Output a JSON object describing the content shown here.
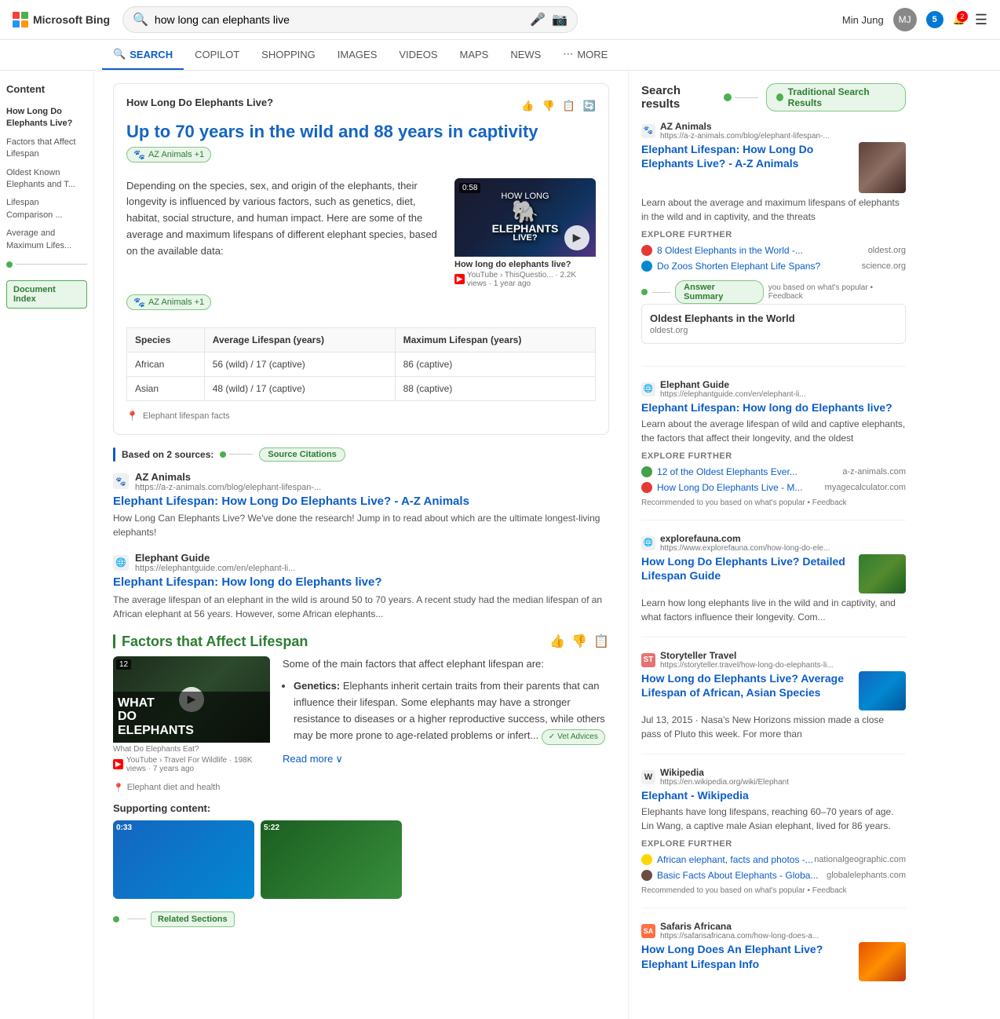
{
  "header": {
    "logo_text": "Microsoft Bing",
    "search_value": "how long can elephants live",
    "user_name": "Min Jung",
    "reward_count": "5",
    "notif_count": "2"
  },
  "nav": {
    "tabs": [
      {
        "label": "SEARCH",
        "icon": "🔍",
        "active": true
      },
      {
        "label": "COPILOT",
        "active": false
      },
      {
        "label": "SHOPPING",
        "active": false
      },
      {
        "label": "IMAGES",
        "active": false
      },
      {
        "label": "VIDEOS",
        "active": false
      },
      {
        "label": "MAPS",
        "active": false
      },
      {
        "label": "NEWS",
        "active": false
      },
      {
        "label": "MORE",
        "active": false
      }
    ]
  },
  "sidebar": {
    "content_label": "Content",
    "items": [
      {
        "label": "How Long Do Elephants Live?",
        "active": true
      },
      {
        "label": "Factors that Affect Lifespan"
      },
      {
        "label": "Oldest Known Elephants and T..."
      },
      {
        "label": "Lifespan Comparison ..."
      },
      {
        "label": "Average and Maximum Lifes..."
      }
    ],
    "doc_index_label": "Document Index"
  },
  "answer": {
    "title": "How Long Do Elephants Live?",
    "main_text": "Up to 70 years in the wild and 88 years in captivity",
    "source_badge": "AZ Animals +1",
    "body_text": "Depending on the species, sex, and origin of the elephants, their longevity is influenced by various factors, such as genetics, diet, habitat, social structure, and human impact. Here are some of the average and maximum lifespans of different elephant species, based on the available data:",
    "source_tag2": "AZ Animals +1",
    "location_text": "Elephant lifespan facts",
    "video": {
      "duration": "0:58",
      "title": "How long do elephants live?",
      "source": "YouTube › ThisQuestio... · 2.2K views · 1 year ago"
    },
    "table": {
      "headers": [
        "Species",
        "Average Lifespan (years)",
        "Maximum Lifespan (years)"
      ],
      "rows": [
        [
          "African",
          "56 (wild) / 17 (captive)",
          "86 (captive)"
        ],
        [
          "Asian",
          "48 (wild) / 17 (captive)",
          "88 (captive)"
        ]
      ]
    }
  },
  "source_citations": {
    "label": "Based on 2 sources:",
    "badge_label": "Source Citations",
    "sources": [
      {
        "icon": "🐾",
        "site": "AZ Animals",
        "url": "https://a-z-animals.com/blog/elephant-lifespan-...",
        "title": "Elephant Lifespan: How Long Do Elephants Live? - A-Z Animals",
        "desc": "How Long Can Elephants Live? We've done the research! Jump in to read about which are the ultimate longest-living elephants!"
      },
      {
        "icon": "🌐",
        "site": "Elephant Guide",
        "url": "https://elephantguide.com/en/elephant-li...",
        "title": "Elephant Lifespan: How long do Elephants live?",
        "desc": "The average lifespan of an elephant in the wild is around 50 to 70 years. A recent study had the median lifespan of an African elephant at 56 years. However, some African elephants..."
      }
    ]
  },
  "factors_section": {
    "title": "Factors that Affect Lifespan",
    "video": {
      "duration": "12",
      "title": "WHAT DO ELEPHANTS",
      "subtitle": "What Do Elephants Eat?",
      "meta": "YouTube › Travel For Wildlife · 198K views · 7 years ago"
    },
    "intro": "Some of the main factors that affect elephant lifespan are:",
    "factors": [
      {
        "keyword": "Genetics:",
        "text": "Elephants inherit certain traits from their parents that can influence their lifespan. Some elephants may have a stronger resistance to diseases or a higher reproductive success, while others may be more prone to age-related problems or infert..."
      },
      {
        "vet_badge": "Vet Advices"
      }
    ],
    "read_more": "Read more",
    "footer_location": "Elephant diet and health",
    "supporting_title": "Supporting content:"
  },
  "related_sections": {
    "label": "Related Sections"
  },
  "right_sidebar": {
    "search_results_label": "Search results",
    "tsr_badge": "Traditional Search Results",
    "items": [
      {
        "icon": "🐾",
        "site": "AZ Animals",
        "url": "https://a-z-animals.com/blog/elephant-lifespan-...",
        "title": "Elephant Lifespan: How Long Do Elephants Live? - A-Z Animals",
        "desc": "Learn about the average and maximum lifespans of elephants in the wild and in captivity, and the threats",
        "has_image": true,
        "img_type": "elephant",
        "explore": [
          {
            "icon": "🌐",
            "text": "8 Oldest Elephants in the World -...",
            "domain": "oldest.org",
            "color": "#e53935"
          },
          {
            "icon": "🔵",
            "text": "Do Zoos Shorten Elephant Life Spans?",
            "domain": "science.org",
            "color": "#0288d1"
          }
        ],
        "answer_summary_badge": true,
        "answer_summary_text": "you based on what's popular • Feedback",
        "oldest_card": {
          "title": "Oldest Elephants in the World",
          "subtitle": "oldest.org"
        }
      },
      {
        "icon": "🌐",
        "site": "Elephant Guide",
        "url": "https://elephantguide.com/en/elephant-li...",
        "title": "Elephant Lifespan: How long do Elephants live?",
        "desc": "Learn about the average lifespan of wild and captive elephants, the factors that affect their longevity, and the oldest",
        "has_image": false,
        "explore": [
          {
            "icon": "🐾",
            "text": "12 of the Oldest Elephants Ever...",
            "domain": "a-z-animals.com",
            "color": "#43a047"
          },
          {
            "icon": "🕐",
            "text": "How Long Do Elephants Live - M...",
            "domain": "myagecalculator.com",
            "color": "#e53935"
          }
        ],
        "recommended_text": "Recommended to you based on what's popular • Feedback"
      },
      {
        "icon": "🌐",
        "site": "explorefauna.com",
        "url": "https://www.explorefauna.com/how-long-do-ele...",
        "title": "How Long Do Elephants Live? Detailed Lifespan Guide",
        "desc": "Learn how long elephants live in the wild and in captivity, and what factors influence their longevity. Com...",
        "has_image": true,
        "img_type": "elephant2"
      },
      {
        "icon": "ST",
        "site": "Storyteller Travel",
        "url": "https://storyteller.travel/how-long-do-elephants-li...",
        "title": "How Long do Elephants Live? Average Lifespan of African, Asian Species",
        "desc": "Jul 13, 2015 · Nasa's New Horizons mission made a close pass of Pluto this week. For more than",
        "has_image": true,
        "img_type": "elephant3"
      },
      {
        "icon": "W",
        "site": "Wikipedia",
        "url": "https://en.wikipedia.org/wiki/Elephant",
        "title": "Elephant - Wikipedia",
        "desc": "Elephants have long lifespans, reaching 60–70 years of age. Lin Wang, a captive male Asian elephant, lived for 86 years.",
        "has_image": false,
        "explore": [
          {
            "icon": "🟡",
            "text": "African elephant, facts and photos -...",
            "domain": "nationalgeographic.com",
            "color": "#ffd600"
          },
          {
            "icon": "🐘",
            "text": "Basic Facts About Elephants - Globa...",
            "domain": "globalelephants.com",
            "color": "#6d4c41"
          }
        ],
        "recommended_text": "Recommended to you based on what's popular • Feedback"
      },
      {
        "icon": "SA",
        "site": "Safaris Africana",
        "url": "https://safarisafricana.com/how-long-does-a...",
        "title": "How Long Does An Elephant Live? Elephant Lifespan Info",
        "desc": "",
        "has_image": true,
        "img_type": "safari"
      }
    ]
  }
}
